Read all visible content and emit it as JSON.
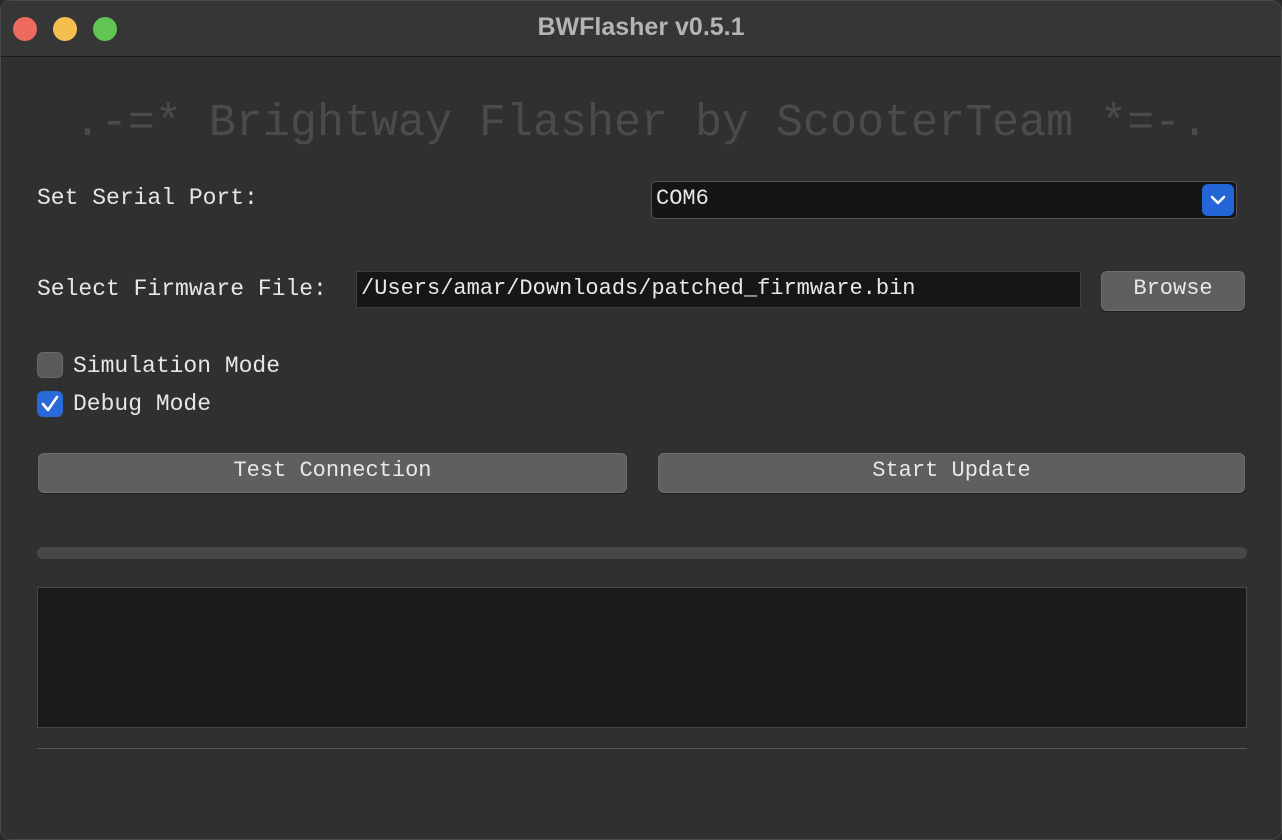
{
  "window": {
    "title": "BWFlasher v0.5.1"
  },
  "banner": {
    "text": ".-=* Brightway Flasher by ScooterTeam *=-."
  },
  "serial_port": {
    "label": "Set Serial Port:",
    "selected": "COM6"
  },
  "firmware": {
    "label": "Select Firmware File:",
    "value": "/Users/amar/Downloads/patched_firmware.bin",
    "browse_label": "Browse"
  },
  "options": {
    "simulation": {
      "label": "Simulation Mode",
      "checked": false
    },
    "debug": {
      "label": "Debug Mode",
      "checked": true
    }
  },
  "actions": {
    "test_label": "Test Connection",
    "start_label": "Start Update"
  },
  "progress": {
    "value": 0
  },
  "log": {
    "text": ""
  },
  "colors": {
    "accent": "#2a6ad8",
    "background": "#303030",
    "button": "#5f5f5f"
  }
}
